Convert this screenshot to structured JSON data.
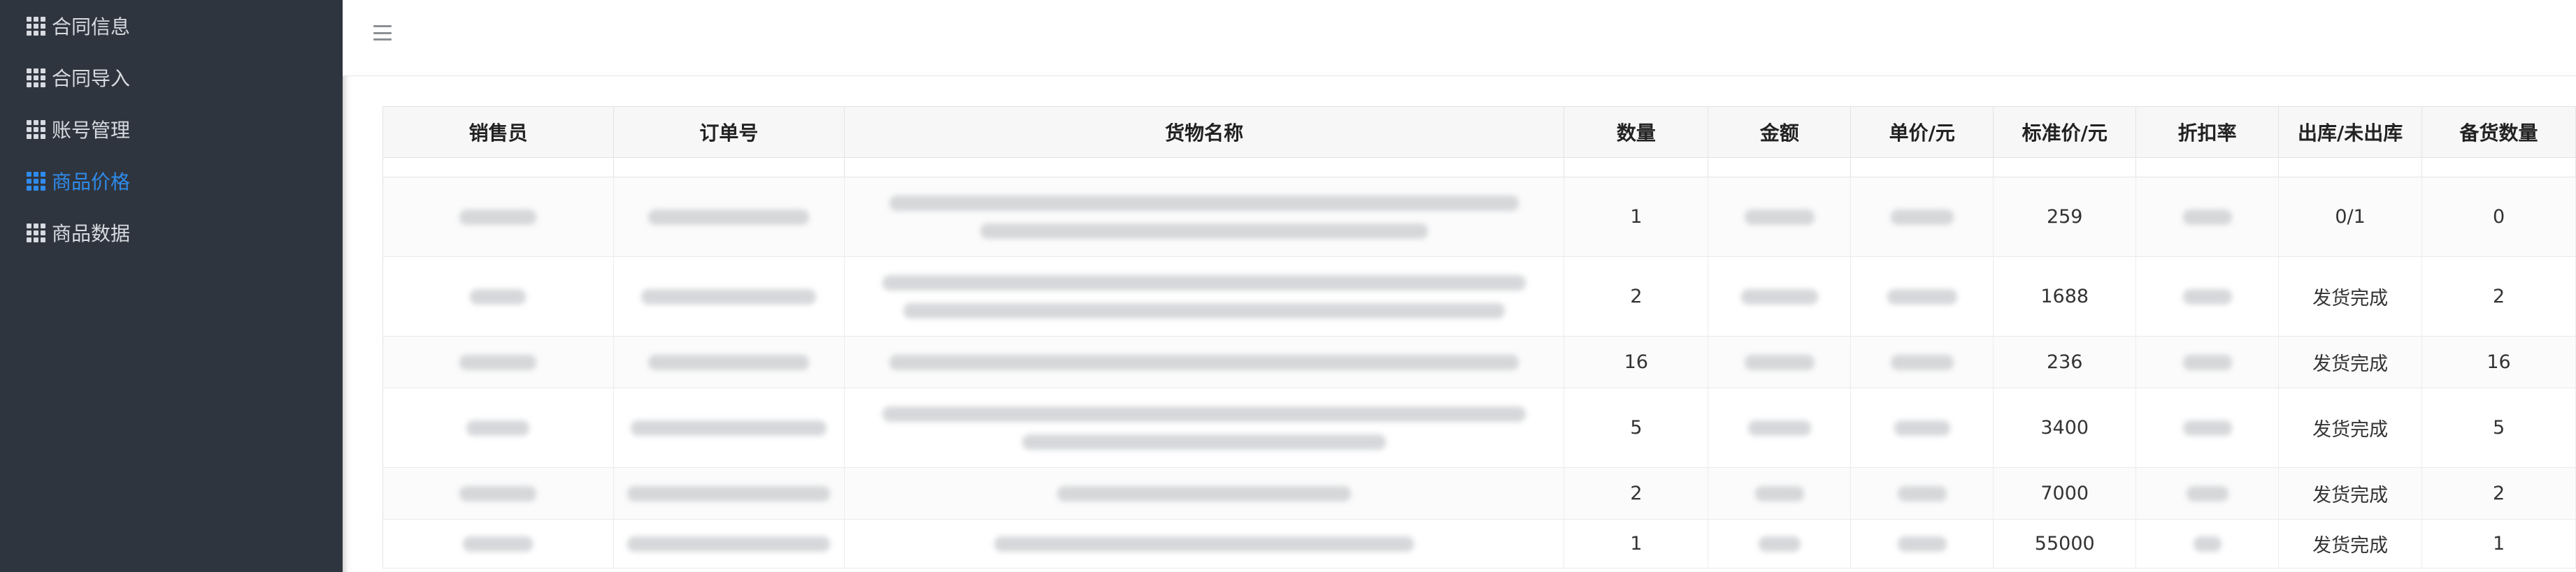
{
  "sidebar": {
    "items": [
      {
        "label": "合同信息",
        "active": false
      },
      {
        "label": "合同导入",
        "active": false
      },
      {
        "label": "账号管理",
        "active": false
      },
      {
        "label": "商品价格",
        "active": true
      },
      {
        "label": "商品数据",
        "active": false
      }
    ]
  },
  "colors": {
    "sidebar_bg": "#2f353e",
    "active": "#2f8bec",
    "nav_text": "#d7dbe1"
  },
  "table": {
    "columns": [
      "销售员",
      "订单号",
      "货物名称",
      "数量",
      "金额",
      "单价/元",
      "标准价/元",
      "折扣率",
      "出库/未出库",
      "备货数量"
    ],
    "rows": [
      {
        "qty": "1",
        "std_price": "259",
        "status": "0/1",
        "stock": "0"
      },
      {
        "qty": "2",
        "std_price": "1688",
        "status": "发货完成",
        "stock": "2"
      },
      {
        "qty": "16",
        "std_price": "236",
        "status": "发货完成",
        "stock": "16"
      },
      {
        "qty": "5",
        "std_price": "3400",
        "status": "发货完成",
        "stock": "5"
      },
      {
        "qty": "2",
        "std_price": "7000",
        "status": "发货完成",
        "stock": "2"
      },
      {
        "qty": "1",
        "std_price": "55000",
        "status": "发货完成",
        "stock": "1"
      }
    ]
  }
}
